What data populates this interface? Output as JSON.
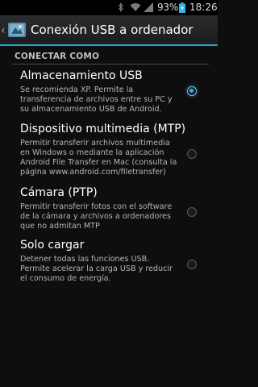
{
  "status_bar": {
    "battery_percent": "93%",
    "time": "18:26",
    "icons": [
      "bluetooth-icon",
      "wifi-icon",
      "signal-icon",
      "battery-icon"
    ]
  },
  "action_bar": {
    "title": "Conexión USB a ordenador",
    "app_icon": "usb-settings-icon"
  },
  "section": {
    "header": "CONECTAR COMO"
  },
  "options": [
    {
      "title": "Almacenamiento USB",
      "description": "Se recomienda XP. Permite la transferencia de archivos entre su PC y su almacenamiento USB de Android.",
      "checked": true
    },
    {
      "title": "Dispositivo multimedia (MTP)",
      "description": "Permitir transferir archivos multimedia en Windows o mediante la aplicación Android File Transfer en Mac (consulta la página www.android.com/filetransfer)",
      "checked": false
    },
    {
      "title": "Cámara (PTP)",
      "description": "Permitir transferir fotos con el software de la cámara y archivos a ordenadores que no admitan MTP",
      "checked": false
    },
    {
      "title": "Solo cargar",
      "description": "Detener todas las funciones USB. Permite acelerar la carga USB y reducir el consumo de energía.",
      "checked": false
    }
  ],
  "colors": {
    "accent": "#2aa0d6",
    "background": "#0e0e0f",
    "battery_charging": "#33b5e5"
  }
}
